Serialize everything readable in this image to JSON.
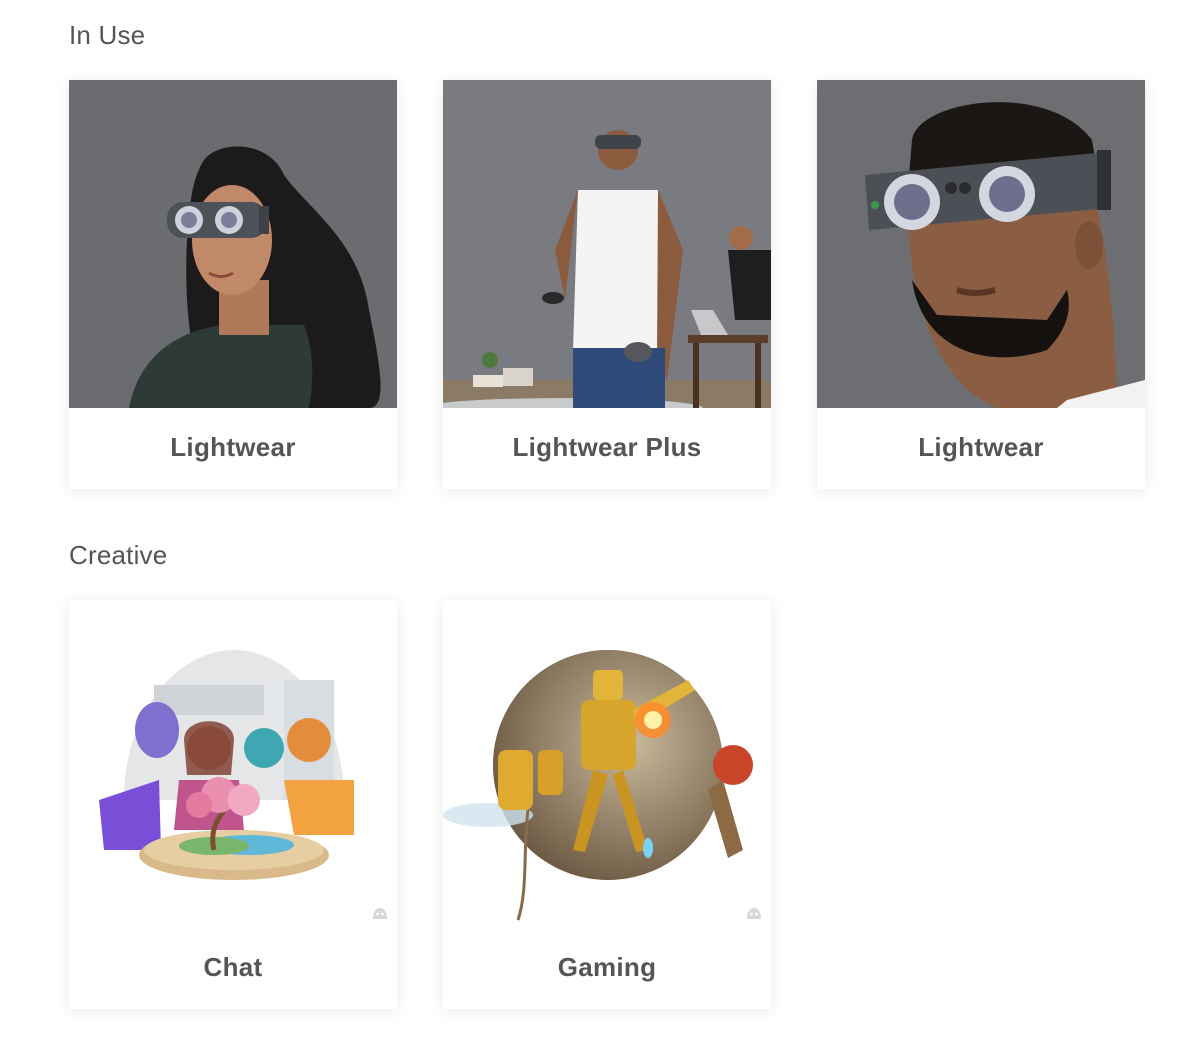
{
  "sections": [
    {
      "title": "In Use",
      "cards": [
        {
          "label": "Lightwear",
          "image": "woman-wearing-headset-photo"
        },
        {
          "label": "Lightwear Plus",
          "image": "man-standing-with-controller-photo"
        },
        {
          "label": "Lightwear",
          "image": "man-closeup-headset-photo"
        }
      ]
    },
    {
      "title": "Creative",
      "cards": [
        {
          "label": "Chat",
          "image": "avatars-chat-illustration"
        },
        {
          "label": "Gaming",
          "image": "robot-gaming-illustration"
        }
      ]
    }
  ],
  "colors": {
    "photo_background": "#6a6b70",
    "headset": "#5c5f66",
    "text": "#555555"
  }
}
